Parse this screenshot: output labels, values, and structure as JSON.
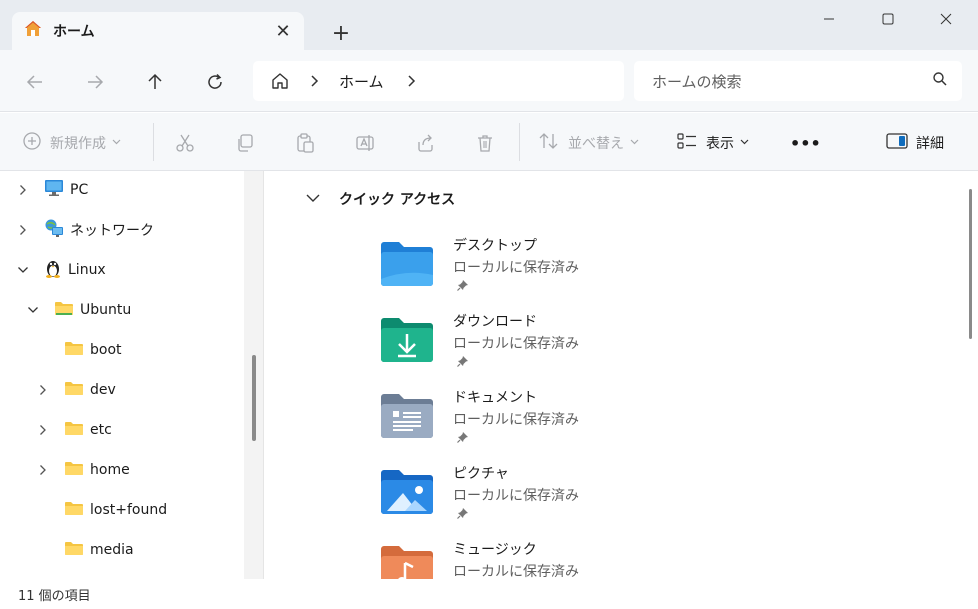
{
  "window": {
    "tab_title": "ホーム",
    "new_tab": "+"
  },
  "navigation": {
    "address_segment": "ホーム",
    "search_placeholder": "ホームの検索"
  },
  "commands": {
    "new": "新規作成",
    "sort": "並べ替え",
    "view": "表示",
    "more": "•••",
    "details": "詳細"
  },
  "sidebar": {
    "items": [
      {
        "label": "PC",
        "icon": "pc-icon",
        "expanded": false
      },
      {
        "label": "ネットワーク",
        "icon": "network-icon",
        "expanded": false
      },
      {
        "label": "Linux",
        "icon": "linux-icon",
        "expanded": true
      },
      {
        "label": "Ubuntu",
        "icon": "folder-icon",
        "expanded": true
      },
      {
        "label": "boot",
        "icon": "folder-icon",
        "has_children": false
      },
      {
        "label": "dev",
        "icon": "folder-icon",
        "has_children": true
      },
      {
        "label": "etc",
        "icon": "folder-icon",
        "has_children": true
      },
      {
        "label": "home",
        "icon": "folder-icon",
        "has_children": true
      },
      {
        "label": "lost+found",
        "icon": "folder-icon",
        "has_children": false
      },
      {
        "label": "media",
        "icon": "folder-icon",
        "has_children": false
      }
    ]
  },
  "quick_access": {
    "header": "クイック アクセス",
    "items": [
      {
        "name": "デスクトップ",
        "location": "ローカルに保存済み",
        "icon": "desktop-folder-icon"
      },
      {
        "name": "ダウンロード",
        "location": "ローカルに保存済み",
        "icon": "downloads-folder-icon"
      },
      {
        "name": "ドキュメント",
        "location": "ローカルに保存済み",
        "icon": "documents-folder-icon"
      },
      {
        "name": "ピクチャ",
        "location": "ローカルに保存済み",
        "icon": "pictures-folder-icon"
      },
      {
        "name": "ミュージック",
        "location": "ローカルに保存済み",
        "icon": "music-folder-icon"
      }
    ]
  },
  "status": {
    "item_count": "11 個の項目"
  },
  "colors": {
    "titlebar": "#e8ecf1",
    "toolbar": "#f6f8fa",
    "folder_yellow": "#f5c542",
    "accent_blue": "#0f6cbd"
  }
}
